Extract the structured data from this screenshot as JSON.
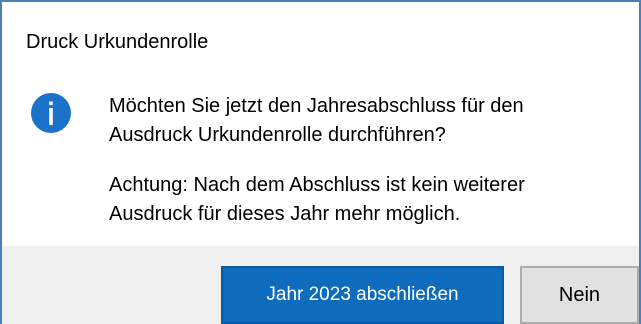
{
  "dialog": {
    "title": "Druck Urkundenrolle",
    "icon": "info-icon",
    "message_line1": "Möchten Sie jetzt den Jahresabschluss für den",
    "message_line2": "Ausdruck Urkundenrolle durchführen?",
    "warning_line1": "Achtung: Nach dem Abschluss ist kein weiterer",
    "warning_line2": "Ausdruck für dieses Jahr mehr möglich."
  },
  "buttons": {
    "confirm_label": "Jahr 2023 abschließen",
    "cancel_label": "Nein"
  },
  "colors": {
    "accent": "#0f6cbd",
    "icon_blue": "#1a73c8",
    "footer_bg": "#f0f0f0",
    "border": "#4a7fb8"
  }
}
